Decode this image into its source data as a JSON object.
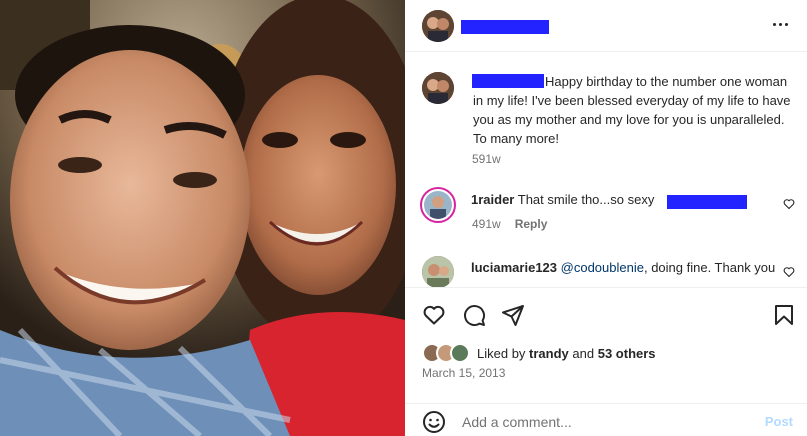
{
  "post": {
    "photo_alt": "Selfie of a smiling man and woman",
    "username": "",
    "more_icon": "more-horizontal-icon"
  },
  "caption": {
    "username": "",
    "text": "Happy birthday to the number one woman in my life! I've been blessed everyday of my life to have you as my mother and my love for you is unparalleled. To many more!",
    "time": "591w"
  },
  "comments": [
    {
      "username": "1raider",
      "text": "That smile tho...so sexy",
      "time": "491w",
      "reply_label": "Reply",
      "like_icon": "heart-outline-icon"
    },
    {
      "username": "luciamarie123",
      "mention": "@codoublenie",
      "text": ", doing fine. Thank you",
      "like_icon": "heart-outline-icon"
    }
  ],
  "actions": {
    "like_icon": "heart-outline-icon",
    "comment_icon": "comment-bubble-icon",
    "share_icon": "paper-plane-icon",
    "save_icon": "bookmark-icon"
  },
  "likes": {
    "prefix": "Liked by",
    "user": "trandy",
    "conjunction": "and",
    "others": "53 others"
  },
  "date": "March 15, 2013",
  "add_comment": {
    "emoji_icon": "emoji-smile-icon",
    "placeholder": "Add a comment...",
    "post_label": "Post"
  },
  "colors": {
    "redaction": "#2323ff",
    "post_button_disabled": "#b3dbff",
    "mention": "#00376b",
    "secondary_text": "#737373"
  }
}
